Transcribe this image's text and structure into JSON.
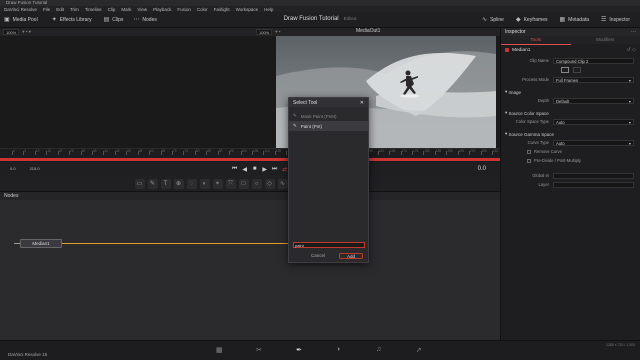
{
  "window_title": "Draw Fusion Tutorial",
  "menu": [
    "DaVinci Resolve",
    "File",
    "Edit",
    "Trim",
    "Timeline",
    "Clip",
    "Mark",
    "View",
    "Playback",
    "Fusion",
    "Color",
    "Fairlight",
    "Workspace",
    "Help"
  ],
  "toolbar": {
    "media_pool": "Media Pool",
    "effects_library": "Effects Library",
    "clips": "Clips",
    "nodes": "Nodes",
    "project_title": "Draw Fusion Tutorial",
    "project_status": "Edited",
    "spline": "Spline",
    "keyframes": "Keyframes",
    "metadata": "Metadata",
    "inspector": "Inspector"
  },
  "viewer": {
    "zoom_left": "100%",
    "zoom_right": "100%",
    "name": "MediaOut1"
  },
  "timeline": {
    "ticks": [
      "0",
      "5",
      "10",
      "15",
      "20",
      "25",
      "30",
      "35",
      "40",
      "45",
      "50",
      "55",
      "60",
      "65",
      "70",
      "75",
      "80",
      "85",
      "90",
      "95",
      "100",
      "105",
      "110",
      "115",
      "120",
      "125",
      "130",
      "135",
      "140",
      "145",
      "150",
      "155",
      "160",
      "165",
      "170",
      "175",
      "180",
      "185",
      "190",
      "195",
      "200",
      "205",
      "210"
    ],
    "start": "0.0",
    "end": "215.0",
    "current_frame": "0.0"
  },
  "nodes": {
    "panel_title": "Nodes",
    "median_node": "Median1"
  },
  "dialog": {
    "title": "Select Tool",
    "items": [
      {
        "label": "Mask Paint (PnM)",
        "selected": false
      },
      {
        "label": "Paint (Pnt)",
        "selected": true
      }
    ],
    "search_value": "paint",
    "cancel_label": "Cancel",
    "add_label": "Add"
  },
  "inspector": {
    "title": "Inspector",
    "tabs": [
      "Tools",
      "Modifiers"
    ],
    "node_name": "Median1",
    "clip_name_label": "Clip Name",
    "clip_name_value": "Compound Clip 2",
    "process_mode_label": "Process Mode",
    "process_mode_value": "Full Frames",
    "image_section": "Image",
    "depth_label": "Depth",
    "depth_value": "Default",
    "source_color_space_section": "Source Color Space",
    "color_space_type_label": "Color Space Type",
    "color_space_type_value": "Auto",
    "source_gamma_section": "Source Gamma Space",
    "curve_type_label": "Curve Type",
    "curve_type_value": "Auto",
    "remove_curve_label": "Remove Curve",
    "pre_divide_label": "Pre-Divide / Post-Multiply",
    "global_in_label": "Global In",
    "layer_label": "Layer"
  },
  "status": {
    "app_name": "DaVinci Resolve 15",
    "dims": "1280 x 720 / 1.000"
  },
  "colors": {
    "accent": "#e05050",
    "link": "#e0a020",
    "playhead": "#cc3333"
  }
}
